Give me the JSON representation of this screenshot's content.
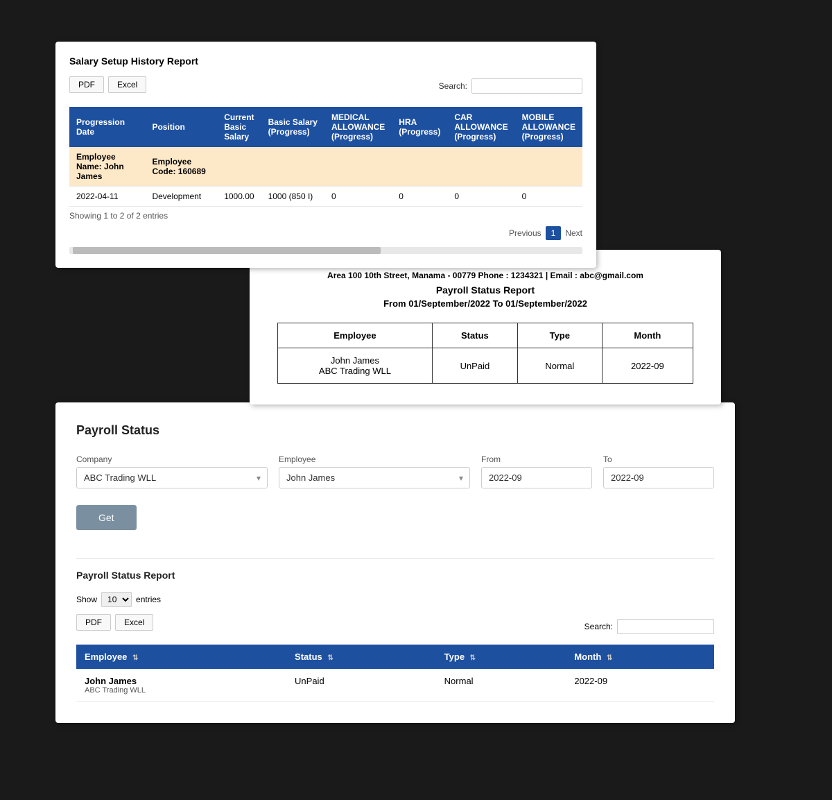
{
  "panel1": {
    "title": "Salary Setup History Report",
    "pdf_btn": "PDF",
    "excel_btn": "Excel",
    "search_label": "Search:",
    "columns": [
      "Progression Date",
      "Position",
      "Current Basic Salary",
      "Basic Salary (Progress)",
      "MEDICAL ALLOWANCE (Progress)",
      "HRA (Progress)",
      "CAR ALLOWANCE (Progress)",
      "MOBILE ALLOWANCE (Progress)"
    ],
    "group_row": {
      "employee_name": "Employee Name: John James",
      "employee_code": "Employee Code: 160689"
    },
    "data_rows": [
      {
        "progression_date": "2022-04-11",
        "position": "Development",
        "current_basic": "1000.00",
        "basic_progress": "1000 (850 I)",
        "medical": "0",
        "hra": "0",
        "car": "0",
        "mobile": "0"
      }
    ],
    "showing_text": "Showing 1 to 2 of 2 entries",
    "pagination": {
      "previous": "Previous",
      "page": "1",
      "next": "Next"
    }
  },
  "panel2": {
    "address": "Area 100 10th Street, Manama - 00779 Phone : 1234321 | Email : abc@gmail.com",
    "report_title": "Payroll Status Report",
    "date_range": "From 01/September/2022 To 01/September/2022",
    "columns": [
      "Employee",
      "Status",
      "Type",
      "Month"
    ],
    "rows": [
      {
        "employee": "John James",
        "company": "ABC Trading WLL",
        "status": "UnPaid",
        "type": "Normal",
        "month": "2022-09"
      }
    ]
  },
  "panel3": {
    "title": "Payroll Status",
    "form": {
      "company_label": "Company",
      "company_value": "ABC Trading WLL",
      "employee_label": "Employee",
      "employee_value": "John James",
      "from_label": "From",
      "from_value": "2022-09",
      "to_label": "To",
      "to_value": "2022-09"
    },
    "get_btn": "Get",
    "report_section": {
      "title": "Payroll Status Report",
      "show_label": "Show",
      "show_value": "10",
      "entries_label": "entries",
      "pdf_btn": "PDF",
      "excel_btn": "Excel",
      "search_label": "Search:",
      "columns": [
        "Employee",
        "Status",
        "Type",
        "Month"
      ],
      "rows": [
        {
          "employee_name": "John James",
          "employee_company": "ABC Trading WLL",
          "status": "UnPaid",
          "type": "Normal",
          "month": "2022-09"
        }
      ]
    }
  }
}
